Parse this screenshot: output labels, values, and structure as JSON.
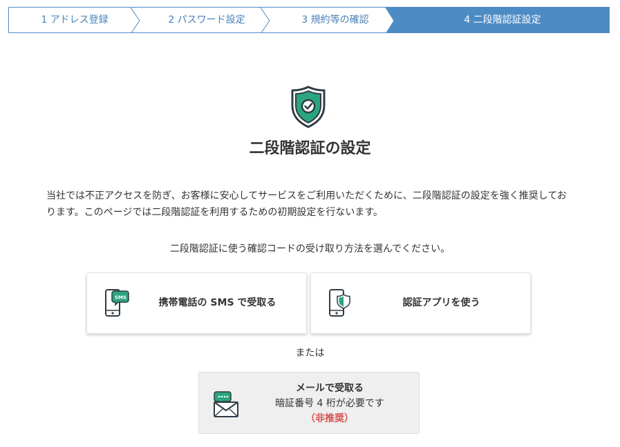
{
  "stepper": {
    "steps": [
      {
        "label": "1 アドレス登録"
      },
      {
        "label": "2 パスワード設定"
      },
      {
        "label": "3 規約等の確認"
      },
      {
        "label": "4 二段階認証設定"
      }
    ],
    "active_index": 3,
    "colors": {
      "border": "#4d8bc4",
      "active_bg": "#4d8bc4",
      "text": "#4a82b8"
    }
  },
  "header": {
    "icon": "shield-check-icon",
    "title": "二段階認証の設定"
  },
  "intro": {
    "line1": "当社では不正アクセスを防ぎ、お客様に安心してサービスをご利用いただくために、二段階認証の設定を強く推奨してお",
    "line2": "ります。このページでは二段階認証を利用するための初期設定を行ないます。"
  },
  "instruction": "二段階認証に使う確認コードの受け取り方法を選んでください。",
  "options": {
    "sms": {
      "label": "携帯電話の SMS で受取る",
      "icon": "phone-sms-icon"
    },
    "app": {
      "label": "認証アプリを使う",
      "icon": "phone-shield-icon"
    }
  },
  "separator": "または",
  "mail_option": {
    "title": "メールで受取る",
    "subtitle": "暗証番号 4 桁が必要です",
    "warning": "（非推奨）",
    "icon": "envelope-icon"
  },
  "colors": {
    "accent_green": "#2aa57d",
    "warning_red": "#d9534f",
    "title_dark": "#333333"
  }
}
